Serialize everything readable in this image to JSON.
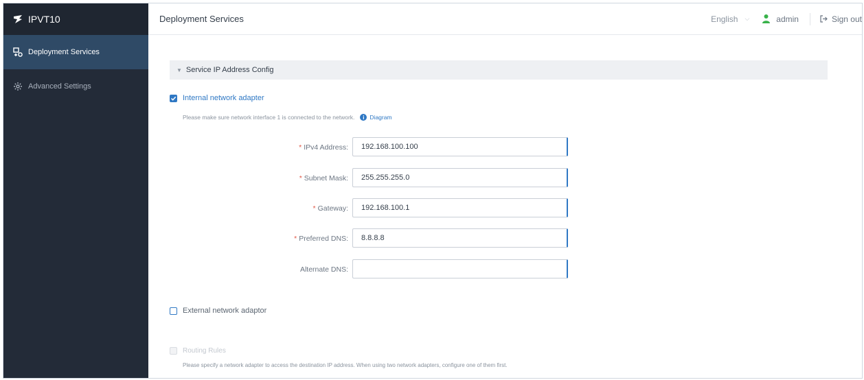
{
  "brand": {
    "name": "IPVT10"
  },
  "sidebar": {
    "items": [
      {
        "label": "Deployment Services",
        "active": true,
        "icon": "deployment-icon"
      },
      {
        "label": "Advanced Settings",
        "active": false,
        "icon": "gear-icon"
      }
    ]
  },
  "header": {
    "title": "Deployment Services",
    "language": "English",
    "user": "admin",
    "signout": "Sign out"
  },
  "section": {
    "title": "Service IP Address Config"
  },
  "internal_adapter": {
    "label": "Internal network adapter",
    "checked": true,
    "hint": "Please make sure network interface 1 is connected to the network.",
    "hint_link": "Diagram"
  },
  "fields": [
    {
      "label": "IPv4 Address:",
      "required": true,
      "value": "192.168.100.100"
    },
    {
      "label": "Subnet Mask:",
      "required": true,
      "value": "255.255.255.0"
    },
    {
      "label": "Gateway:",
      "required": true,
      "value": "192.168.100.1"
    },
    {
      "label": "Preferred DNS:",
      "required": true,
      "value": "8.8.8.8"
    },
    {
      "label": "Alternate DNS:",
      "required": false,
      "value": ""
    }
  ],
  "external_adapter": {
    "label": "External network adaptor",
    "checked": false
  },
  "routing_rules": {
    "label": "Routing Rules",
    "disabled": true,
    "hint": "Please specify a network adapter to access the destination IP address. When using two network adapters, configure one of them first."
  },
  "colors": {
    "sidebar_bg": "#232b38",
    "active_bg": "#2f4a66",
    "accent": "#2f78c4",
    "required": "#e05a4a"
  }
}
